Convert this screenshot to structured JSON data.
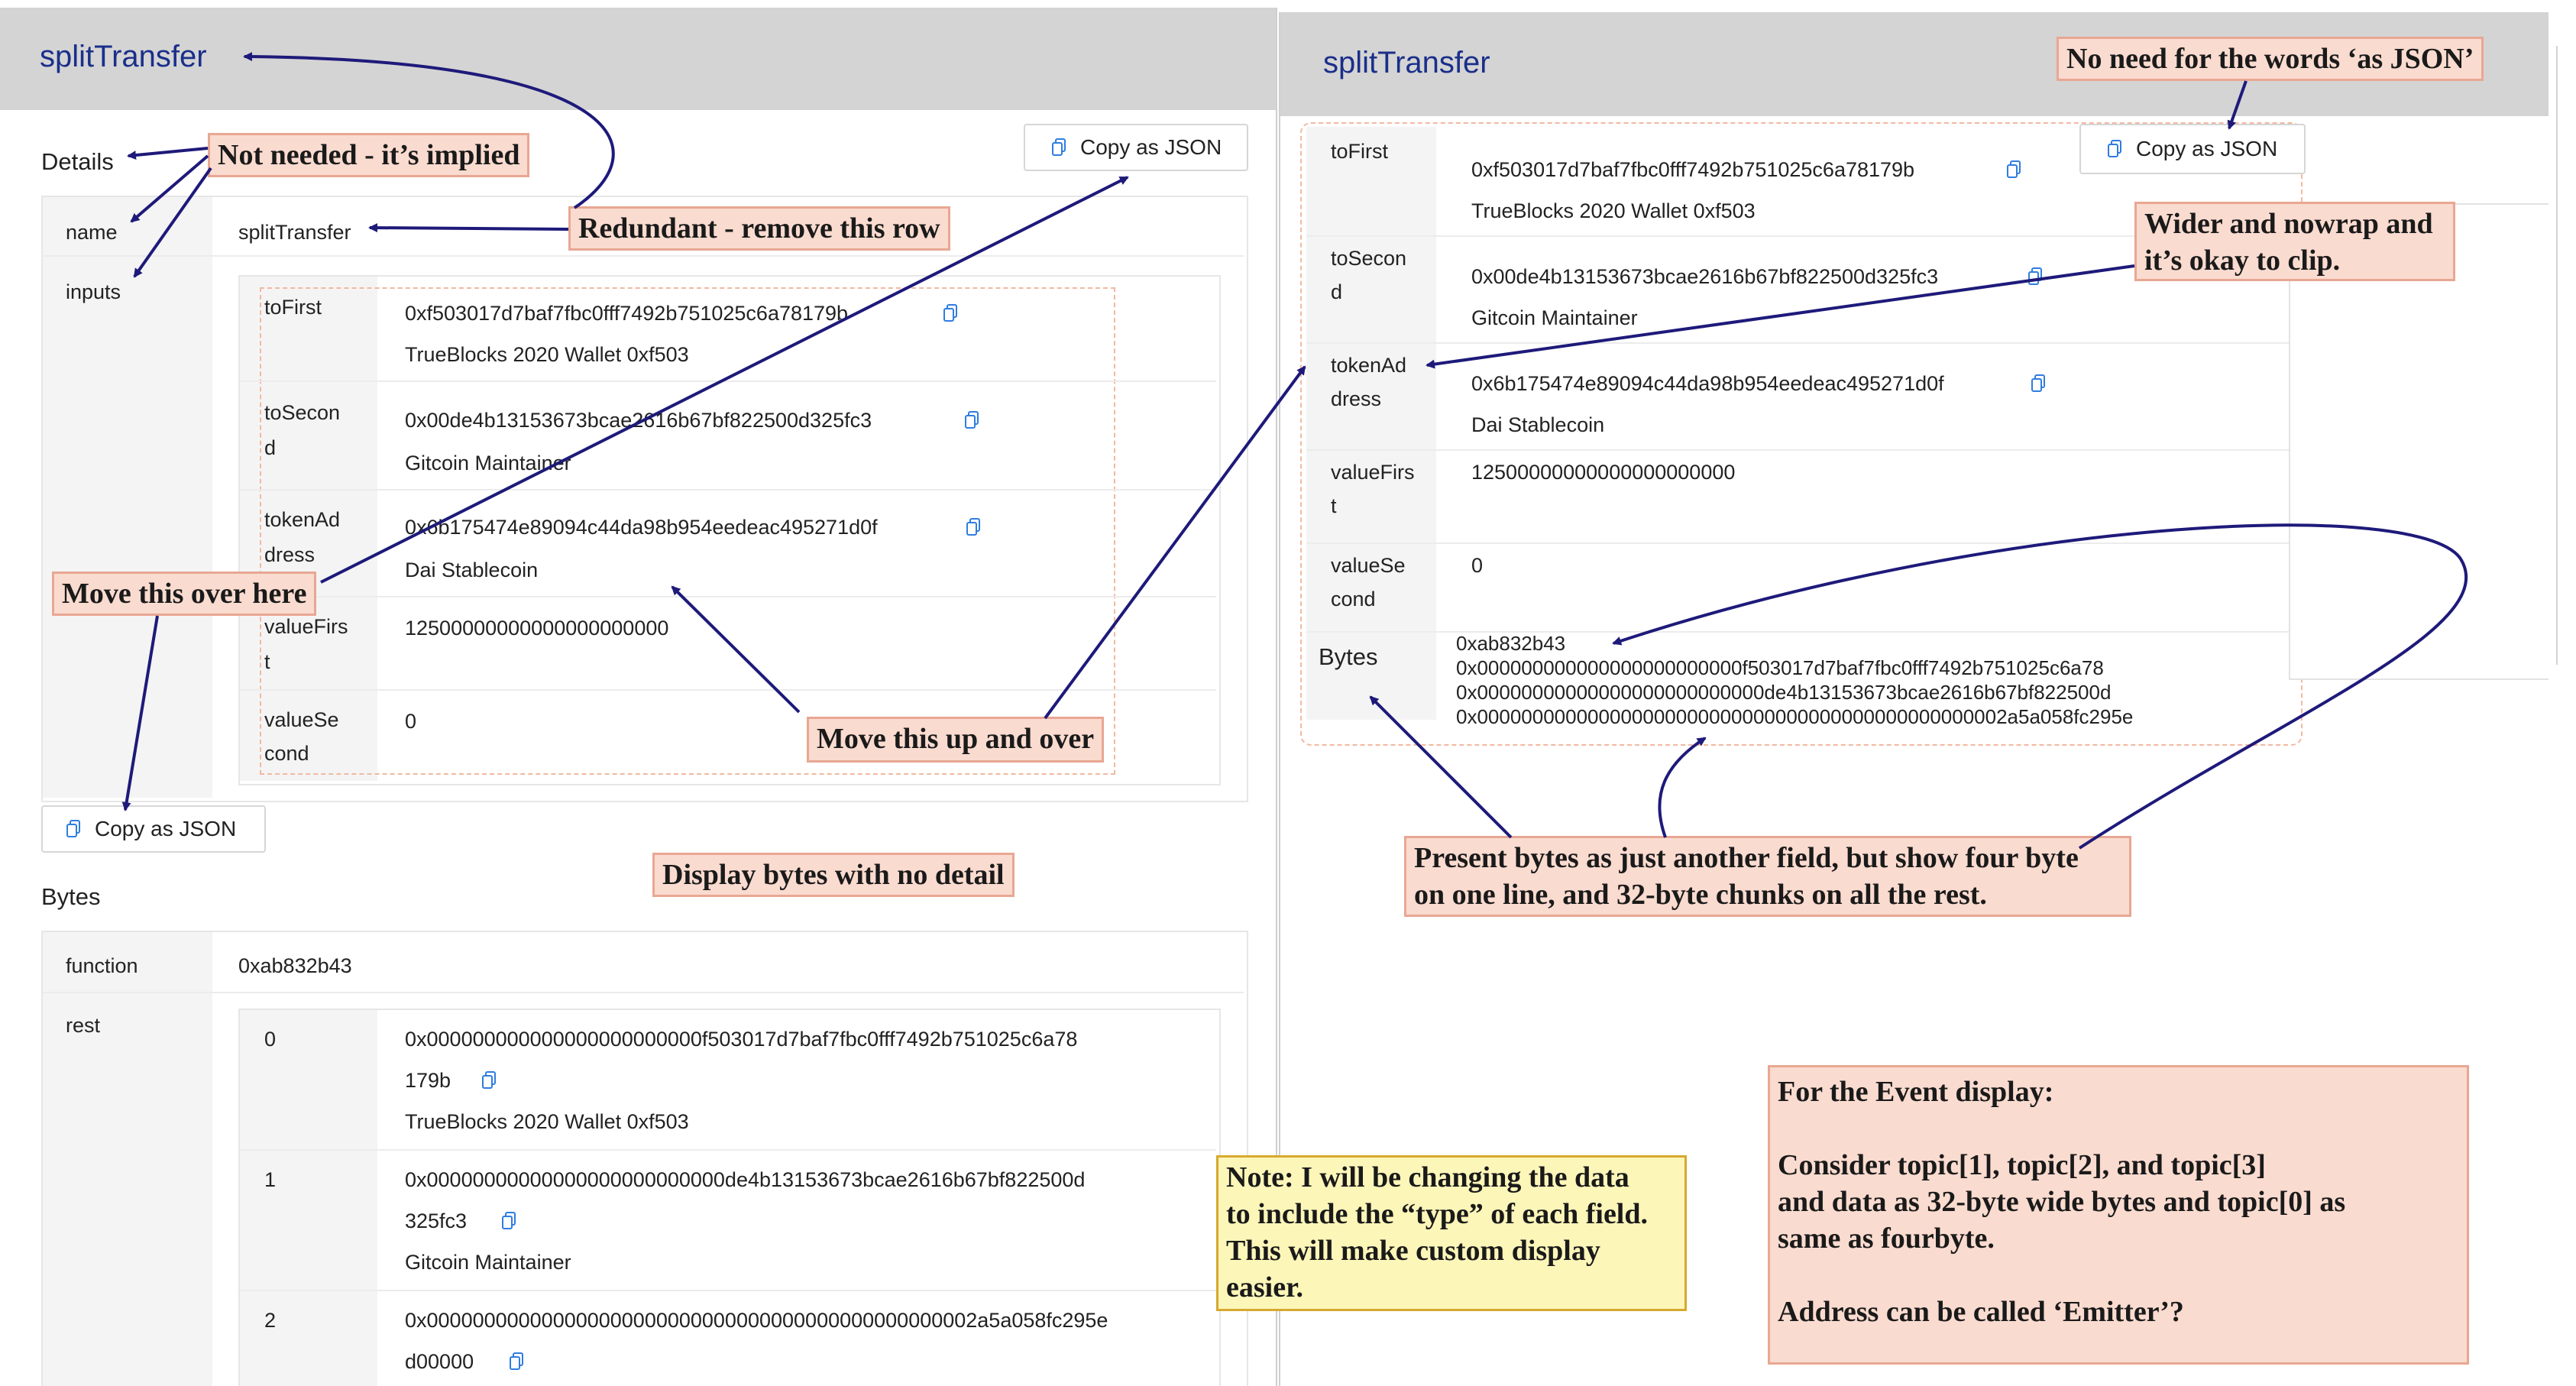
{
  "colors": {
    "title": "#1a2f8a",
    "copy_icon": "#2f7de1",
    "annotation_bg": "#fadbcf",
    "annotation_border": "#e8a793",
    "note_bg": "#fdf6b9",
    "arrow": "#1e1a7a"
  },
  "left": {
    "title": "splitTransfer",
    "details_label": "Details",
    "copy_json_top": "Copy as JSON",
    "name_label": "name",
    "name_value": "splitTransfer",
    "inputs_label": "inputs",
    "inputs": [
      {
        "label1": "toFirst",
        "label2": "",
        "value": "0xf503017d7baf7fbc0fff7492b751025c6a78179b",
        "sub": "TrueBlocks 2020 Wallet 0xf503",
        "copy": true
      },
      {
        "label1": "toSecon",
        "label2": "d",
        "value": "0x00de4b13153673bcae2616b67bf822500d325fc3",
        "sub": "Gitcoin Maintainer",
        "copy": true
      },
      {
        "label1": "tokenAd",
        "label2": "dress",
        "value": "0x6b175474e89094c44da98b954eedeac495271d0f",
        "sub": "Dai Stablecoin",
        "copy": true
      },
      {
        "label1": "valueFirs",
        "label2": "t",
        "value": "12500000000000000000000",
        "sub": "",
        "copy": false
      },
      {
        "label1": "valueSe",
        "label2": "cond",
        "value": "0",
        "sub": "",
        "copy": false
      }
    ],
    "copy_json_bottom": "Copy as JSON",
    "bytes_label": "Bytes",
    "function_label": "function",
    "function_value": "0xab832b43",
    "rest_label": "rest",
    "rest": [
      {
        "index": "0",
        "line1": "0x000000000000000000000000f503017d7baf7fbc0fff7492b751025c6a78",
        "line2": "179b",
        "sub": "TrueBlocks 2020 Wallet 0xf503"
      },
      {
        "index": "1",
        "line1": "0x00000000000000000000000000de4b13153673bcae2616b67bf822500d",
        "line2": "325fc3",
        "sub": "Gitcoin Maintainer"
      },
      {
        "index": "2",
        "line1": "0x000000000000000000000000000000000000000000000002a5a058fc295e",
        "line2": "d00000",
        "sub": ""
      }
    ]
  },
  "right": {
    "title": "splitTransfer",
    "copy_json": "Copy as JSON",
    "fields": [
      {
        "label1": "toFirst",
        "label2": "",
        "value": "0xf503017d7baf7fbc0fff7492b751025c6a78179b",
        "sub": "TrueBlocks 2020 Wallet 0xf503",
        "copy": true
      },
      {
        "label1": "toSecon",
        "label2": "d",
        "value": "0x00de4b13153673bcae2616b67bf822500d325fc3",
        "sub": "Gitcoin Maintainer",
        "copy": true
      },
      {
        "label1": "tokenAd",
        "label2": "dress",
        "value": "0x6b175474e89094c44da98b954eedeac495271d0f",
        "sub": "Dai Stablecoin",
        "copy": true
      },
      {
        "label1": "valueFirs",
        "label2": "t",
        "value": "12500000000000000000000",
        "sub": "",
        "copy": false
      },
      {
        "label1": "valueSe",
        "label2": "cond",
        "value": "0",
        "sub": "",
        "copy": false
      }
    ],
    "bytes_label": "Bytes",
    "bytes_lines": [
      "0xab832b43",
      "0x000000000000000000000000f503017d7baf7fbc0fff7492b751025c6a78",
      "0x00000000000000000000000000de4b13153673bcae2616b67bf822500d",
      "0x000000000000000000000000000000000000000000000002a5a058fc295e"
    ]
  },
  "annotations": {
    "not_needed": "Not needed - it’s implied",
    "redundant": "Redundant - remove this row",
    "move_over": "Move this over here",
    "move_up": "Move this up and over",
    "display_bytes": "Display bytes with no detail",
    "no_need": "No need for the words ‘as JSON’",
    "wider_1": "Wider and nowrap and",
    "wider_2": "it’s okay to clip.",
    "present_1": "Present bytes as just another field, but show four byte",
    "present_2": "on one line, and 32-byte chunks on all the rest.",
    "note_1": "Note: I will be changing the data",
    "note_2": "to include the “type” of each field.",
    "note_3": "This will make custom display",
    "note_4": "easier.",
    "event_1": "For the Event display:",
    "event_2": "Consider topic[1], topic[2], and topic[3]",
    "event_3": "and data as 32-byte wide bytes and topic[0] as",
    "event_4": "same as fourbyte.",
    "event_5": "Address can be called ‘Emitter’?"
  }
}
